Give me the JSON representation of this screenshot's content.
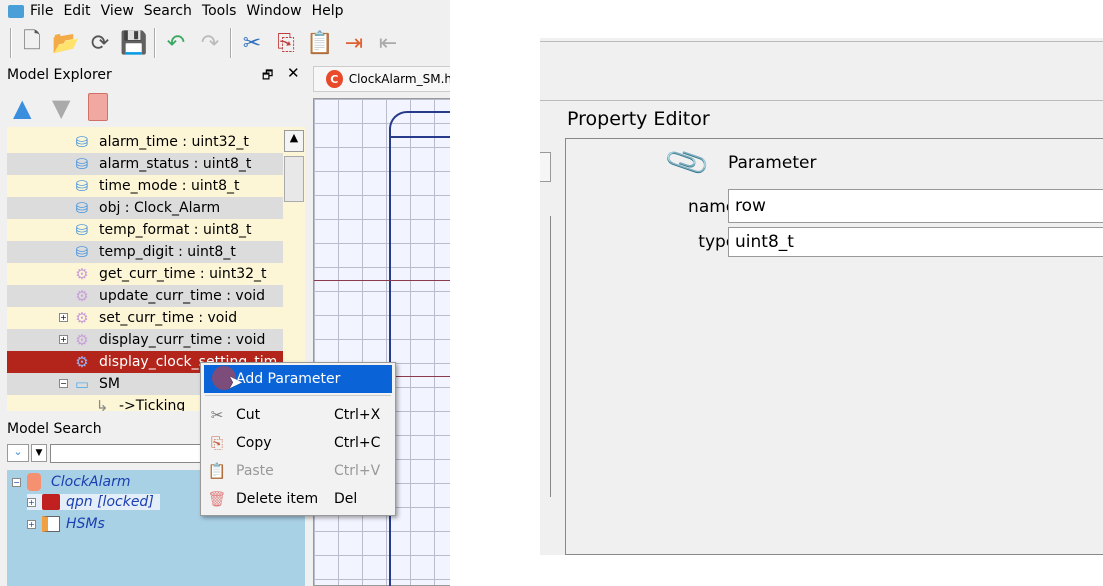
{
  "menu": [
    "File",
    "Edit",
    "View",
    "Search",
    "Tools",
    "Window",
    "Help"
  ],
  "toolbar": {
    "icons": [
      "new-model-icon",
      "open-icon",
      "reload-icon",
      "save-icon",
      "undo-icon",
      "redo-icon",
      "cut-icon",
      "copy-icon",
      "paste-icon",
      "link-icon",
      "unlink-icon"
    ]
  },
  "model_explorer": {
    "title": "Model Explorer",
    "tree": [
      {
        "label": "alarm_time : uint32_t",
        "icon": "attribute-icon"
      },
      {
        "label": "alarm_status : uint8_t",
        "icon": "attribute-icon"
      },
      {
        "label": "time_mode : uint8_t",
        "icon": "attribute-icon"
      },
      {
        "label": "obj : Clock_Alarm",
        "icon": "attribute-icon"
      },
      {
        "label": "temp_format : uint8_t",
        "icon": "attribute-icon"
      },
      {
        "label": "temp_digit : uint8_t",
        "icon": "attribute-icon"
      },
      {
        "label": "get_curr_time : uint32_t",
        "icon": "operation-icon"
      },
      {
        "label": "update_curr_time : void",
        "icon": "operation-icon"
      },
      {
        "label": "set_curr_time : void",
        "icon": "operation-icon"
      },
      {
        "label": "display_curr_time : void",
        "icon": "operation-icon"
      },
      {
        "label": "display_clock_setting_tim",
        "icon": "operation-icon",
        "selected": true
      },
      {
        "label": "SM",
        "icon": "state-machine-icon"
      },
      {
        "label": "->Ticking",
        "icon": "initial-transition-icon"
      }
    ]
  },
  "editor_tab": {
    "label": "ClockAlarm_SM.h"
  },
  "context_menu": {
    "items": [
      {
        "label": "Add Parameter",
        "shortcut": "",
        "highlighted": true
      },
      {
        "label": "Cut",
        "shortcut": "Ctrl+X"
      },
      {
        "label": "Copy",
        "shortcut": "Ctrl+C"
      },
      {
        "label": "Paste",
        "shortcut": "Ctrl+V",
        "disabled": true
      },
      {
        "label": "Delete item",
        "shortcut": "Del"
      }
    ]
  },
  "model_search": {
    "title": "Model Search",
    "input_value": "",
    "tree": [
      {
        "label": "ClockAlarm"
      },
      {
        "label": "qpn [locked]"
      },
      {
        "label": "HSMs"
      }
    ]
  },
  "property_editor": {
    "title": "Property Editor",
    "kind": "Parameter",
    "name_label": "name:",
    "name_value": "row",
    "type_label": "type:",
    "type_value": "uint8_t"
  },
  "colors": {
    "selection": "#b3251b",
    "menu_highlight": "#0a64d8",
    "search_tree_bg": "#a9d1e6"
  }
}
